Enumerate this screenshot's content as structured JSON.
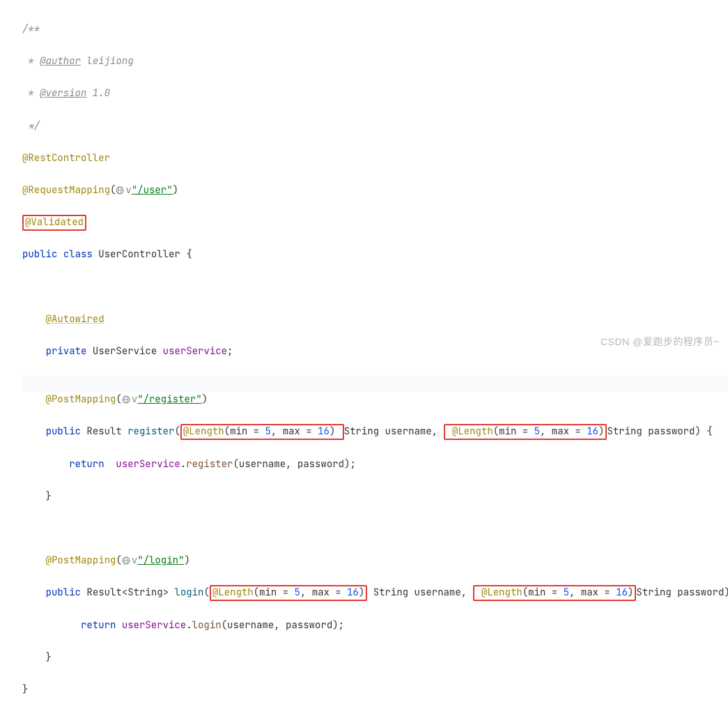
{
  "code": {
    "comment_open": "/**",
    "author_line": " * ",
    "author_tag": "@author",
    "author_value": " leijiong",
    "version_line": " * ",
    "version_tag": "@version",
    "version_value": " 1.0",
    "comment_close": " */",
    "ann_restcontroller": "@RestController",
    "ann_requestmapping": "@RequestMapping",
    "requestmapping_path": "\"/user\"",
    "ann_validated": "@Validated",
    "kw_public": "public",
    "kw_class": "class",
    "class_name": "UserController",
    "ann_autowired": "@Autowired",
    "kw_private": "private",
    "type_userservice": "UserService",
    "field_userservice": "userService",
    "ann_postmapping": "@PostMapping",
    "register_path": "\"/register\"",
    "type_result": "Result",
    "method_register": "register",
    "ann_length": "@Length",
    "length_min_label": "min",
    "length_max_label": "max",
    "len_min": "5",
    "len_max": "16",
    "type_string": "String",
    "param_username": "username",
    "param_password": "password",
    "kw_return": "return",
    "reg_call": "register",
    "login_path": "\"/login\"",
    "type_result_generic": "Result<String>",
    "method_login": "login",
    "login_call": "login",
    "paren_open": "(",
    "paren_close": ")",
    "brace_open": "{",
    "brace_close": "}",
    "comma": ", ",
    "semicolon": ";",
    "eq": " = ",
    "dot": ".",
    "dropdown_v": "v"
  },
  "watermark": "CSDN @爱跑步的程序员~"
}
